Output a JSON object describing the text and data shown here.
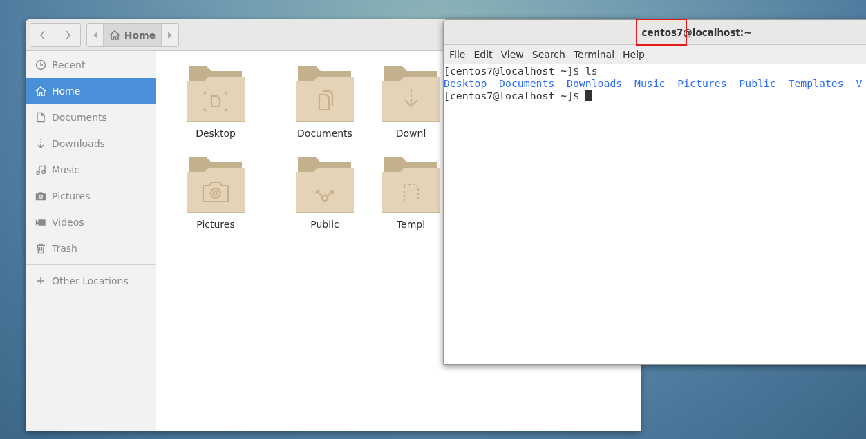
{
  "file_manager": {
    "path_bar": {
      "label": "Home"
    },
    "sidebar": {
      "items": [
        {
          "label": "Recent",
          "kind": "recent",
          "selected": false
        },
        {
          "label": "Home",
          "kind": "home",
          "selected": true
        },
        {
          "label": "Documents",
          "kind": "documents",
          "selected": false
        },
        {
          "label": "Downloads",
          "kind": "downloads",
          "selected": false
        },
        {
          "label": "Music",
          "kind": "music",
          "selected": false
        },
        {
          "label": "Pictures",
          "kind": "pictures",
          "selected": false
        },
        {
          "label": "Videos",
          "kind": "videos",
          "selected": false
        },
        {
          "label": "Trash",
          "kind": "trash",
          "selected": false
        }
      ],
      "other_locations": "Other Locations"
    },
    "folders": [
      {
        "label": "Desktop",
        "kind": "desktop"
      },
      {
        "label": "Documents",
        "kind": "documents"
      },
      {
        "label": "Downl",
        "kind": "downloads"
      },
      {
        "label": "Pictures",
        "kind": "pictures"
      },
      {
        "label": "Public",
        "kind": "public"
      },
      {
        "label": "Templ",
        "kind": "templates"
      }
    ]
  },
  "terminal": {
    "title": "centos7@localhost:~",
    "highlight": true,
    "menu": [
      "File",
      "Edit",
      "View",
      "Search",
      "Terminal",
      "Help"
    ],
    "lines": [
      {
        "kind": "prompt",
        "prompt": "[centos7@localhost ~]$",
        "command": "ls"
      },
      {
        "kind": "listing",
        "entries": [
          "Desktop",
          "Documents",
          "Downloads",
          "Music",
          "Pictures",
          "Public",
          "Templates",
          "V"
        ]
      },
      {
        "kind": "prompt",
        "prompt": "[centos7@localhost ~]$",
        "cursor": true
      }
    ]
  }
}
